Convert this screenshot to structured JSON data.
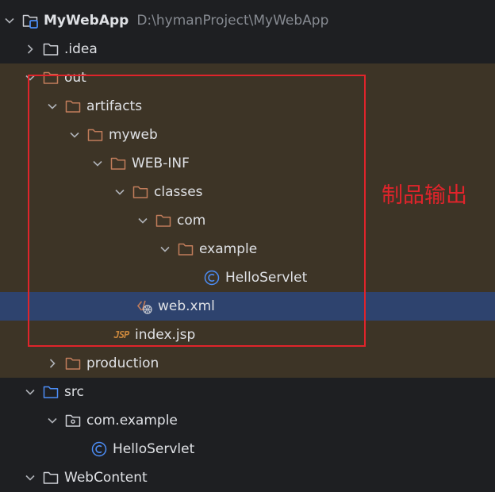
{
  "tree": {
    "root": {
      "name": "MyWebApp",
      "path": "D:\\hymanProject\\MyWebApp"
    },
    "items": {
      "idea": ".idea",
      "out": "out",
      "artifacts": "artifacts",
      "myweb": "myweb",
      "webinf": "WEB-INF",
      "classes": "classes",
      "com": "com",
      "example": "example",
      "servlet_class": "HelloServlet",
      "webxml": "web.xml",
      "indexjsp": "index.jsp",
      "production": "production",
      "src": "src",
      "package": "com.example",
      "servlet_source": "HelloServlet",
      "webcontent": "WebContent"
    }
  },
  "annotation": {
    "text": "制品输出",
    "color": "#e0242b"
  },
  "colors": {
    "background": "#1e1f22",
    "excluded_bg": "#3d3426",
    "selected_bg": "#2e436e",
    "excluded_folder": "#c27d5b",
    "source_folder": "#4c8df6",
    "folder": "#ced0d6"
  },
  "icons": {
    "module": "module-folder-icon",
    "folder": "folder-icon",
    "excluded_folder": "excluded-folder-icon",
    "source_folder": "source-folder-icon",
    "package": "package-icon",
    "class": "java-class-icon",
    "xml": "xml-file-icon",
    "jsp": "jsp-file-icon",
    "expanded": "chevron-down-icon",
    "collapsed": "chevron-right-icon"
  }
}
